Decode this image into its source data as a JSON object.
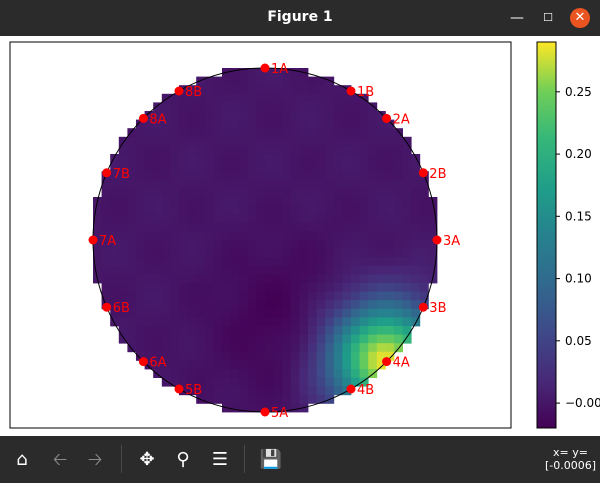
{
  "window": {
    "title": "Figure 1",
    "minimize_glyph": "—",
    "maximize_glyph": "☐",
    "close_glyph": "✕"
  },
  "colors": {
    "titlebar": "#2b2b2b",
    "close_button": "#e95420",
    "marker": "#ff0000",
    "marker_label": "#ff0000"
  },
  "toolbar": {
    "icons": [
      "home-icon",
      "back-arrow-icon",
      "forward-arrow-icon",
      "pan-move-icon",
      "zoom-magnifier-icon",
      "configure-subplots-icon",
      "save-floppy-icon"
    ],
    "coordinates_line1": "x= y=",
    "coordinates_line2": "[-0.0006]"
  },
  "chart_data": {
    "type": "heatmap",
    "colormap": "viridis",
    "description_shape": "circular wafer map",
    "colorbar": {
      "min": -0.02,
      "max": 0.29,
      "ticks": [
        -0.0,
        0.05,
        0.1,
        0.15,
        0.2,
        0.25
      ],
      "tick_labels": [
        "−0.00",
        "0.05",
        "0.10",
        "0.15",
        "0.20",
        "0.25"
      ]
    },
    "field": {
      "background_value": 0.0,
      "hotspot": {
        "peak_value": 0.29,
        "position": "lower-right near 4A"
      },
      "trough": {
        "value": -0.02,
        "position": "center toward lower-right"
      }
    },
    "markers": [
      {
        "label": "1A",
        "angle_deg": 90
      },
      {
        "label": "1B",
        "angle_deg": 60
      },
      {
        "label": "2A",
        "angle_deg": 45
      },
      {
        "label": "2B",
        "angle_deg": 23
      },
      {
        "label": "3A",
        "angle_deg": 0
      },
      {
        "label": "3B",
        "angle_deg": -23
      },
      {
        "label": "4A",
        "angle_deg": -45
      },
      {
        "label": "4B",
        "angle_deg": -60
      },
      {
        "label": "5A",
        "angle_deg": -90
      },
      {
        "label": "5B",
        "angle_deg": -120
      },
      {
        "label": "6A",
        "angle_deg": -135
      },
      {
        "label": "6B",
        "angle_deg": -157
      },
      {
        "label": "7A",
        "angle_deg": 180
      },
      {
        "label": "7B",
        "angle_deg": 157
      },
      {
        "label": "8A",
        "angle_deg": 135
      },
      {
        "label": "8B",
        "angle_deg": 120
      }
    ]
  }
}
